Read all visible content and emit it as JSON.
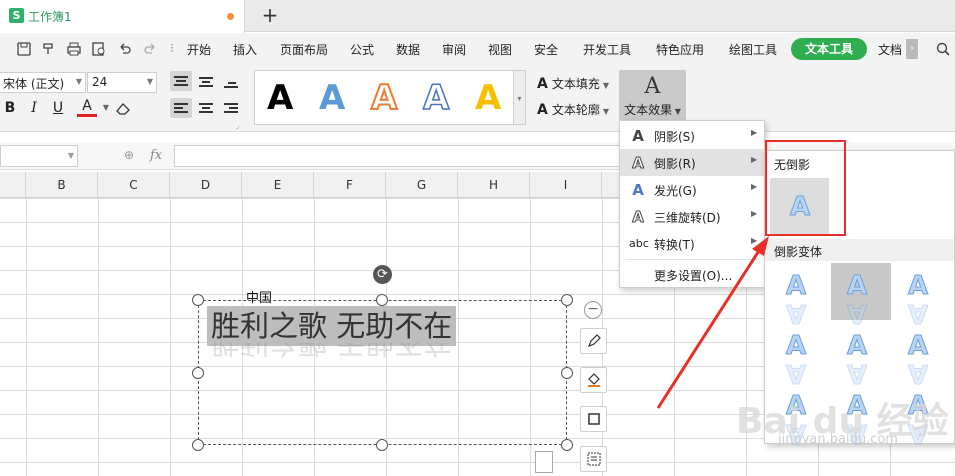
{
  "tab": {
    "app_badge": "S",
    "title": "工作簿1"
  },
  "menu": {
    "quick_icons": [
      "save-icon",
      "format-painter-icon",
      "print-icon",
      "print-preview-icon",
      "undo-icon",
      "redo-icon"
    ],
    "items": [
      "开始",
      "插入",
      "页面布局",
      "公式",
      "数据",
      "审阅",
      "视图",
      "安全",
      "开发工具",
      "特色应用",
      "绘图工具",
      "文本工具",
      "文档"
    ],
    "more": "›",
    "active_item": "文本工具",
    "active_color": "#2fae4f"
  },
  "ribbon": {
    "font_name": "宋体 (正文)",
    "font_size": "24",
    "bold": "B",
    "italic": "I",
    "underline": "U",
    "font_color_label": "A",
    "gallery": [
      {
        "char": "A",
        "fill": "#000000",
        "stroke": "#000000"
      },
      {
        "char": "A",
        "fill": "#5b9bd5",
        "stroke": "#5b9bd5"
      },
      {
        "char": "A",
        "fill": "#ffffff",
        "stroke": "#ed7d31"
      },
      {
        "char": "A",
        "fill": "#ffffff",
        "stroke": "#4472c4"
      },
      {
        "char": "A",
        "fill": "#f5c000",
        "stroke": "#f5c000"
      }
    ],
    "text_fill": "文本填充",
    "text_outline": "文本轮廓",
    "text_effect": "文本效果"
  },
  "formula": {
    "fx": "fx",
    "value": ""
  },
  "columns": [
    "B",
    "C",
    "D",
    "E",
    "F",
    "G",
    "H",
    "I"
  ],
  "sheet": {
    "label_above": "中国",
    "textbox_text": "胜利之歌 无助不在"
  },
  "effect_menu": [
    {
      "icon": "A",
      "label": "阴影(S)",
      "has_sub": true
    },
    {
      "icon": "A",
      "label": "倒影(R)",
      "has_sub": true,
      "hover": true
    },
    {
      "icon": "A",
      "label": "发光(G)",
      "has_sub": true
    },
    {
      "icon": "A",
      "label": "三维旋转(D)",
      "has_sub": true
    },
    {
      "icon": "abc",
      "label": "转换(T)",
      "has_sub": true
    },
    {
      "icon": "",
      "label": "更多设置(O)...",
      "has_sub": false
    }
  ],
  "reflect_panel": {
    "none_label": "无倒影",
    "variants_label": "倒影变体",
    "variant_count": 9,
    "selected_index": 1
  },
  "watermark": {
    "main": "Bai du 经验",
    "sub": "jingyan.baidu.com"
  },
  "colors": {
    "highlight": "#e8302b",
    "brand_green": "#2fae4f"
  }
}
